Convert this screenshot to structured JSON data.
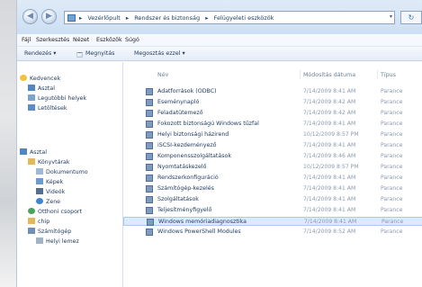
{
  "address": {
    "breadcrumbs": [
      "Vezérlőpult",
      "Rendszer és biztonság",
      "Felügyeleti eszközök"
    ],
    "separator": "▸"
  },
  "menu": [
    "Fájl",
    "Szerkesztés",
    "Nézet",
    "Eszközök",
    "Súgó"
  ],
  "commands": {
    "organize": "Rendezés ▾",
    "open": "Megnyitás",
    "share": "Megosztás ezzel ▾"
  },
  "navpane": {
    "favorites": "Kedvencek",
    "desktop": "Asztal",
    "recent": "Legutóbbi helyek",
    "downloads": "Letöltések",
    "desktop2": "Asztal",
    "libraries": "Könyvtárak",
    "documents": "Dokumentumo",
    "pictures": "Képek",
    "videos": "Videók",
    "music": "Zene",
    "homegroup": "Otthoni csoport",
    "chip": "chip",
    "computer": "Számítógép",
    "drive": "Helyi lemez"
  },
  "columns": {
    "name": "Név",
    "date": "Módosítás dátuma",
    "type": "Típus"
  },
  "files": [
    {
      "name": "Adatforrások (ODBC)",
      "date": "7/14/2009 8:41 AM",
      "type": "Parance"
    },
    {
      "name": "Eseménynapló",
      "date": "7/14/2009 8:42 AM",
      "type": "Parance"
    },
    {
      "name": "Feladatütemező",
      "date": "7/14/2009 8:42 AM",
      "type": "Parance"
    },
    {
      "name": "Fokozott biztonságú Windows tűzfal",
      "date": "7/14/2009 8:41 AM",
      "type": "Parance"
    },
    {
      "name": "Helyi biztonsági házirend",
      "date": "10/12/2009 8:57 PM",
      "type": "Parance"
    },
    {
      "name": "iSCSI-kezdeményező",
      "date": "7/14/2009 8:41 AM",
      "type": "Parance"
    },
    {
      "name": "Komponensszolgáltatások",
      "date": "7/14/2009 8:46 AM",
      "type": "Parance"
    },
    {
      "name": "Nyomtatáskezelő",
      "date": "10/12/2009 8:57 PM",
      "type": "Parance"
    },
    {
      "name": "Rendszerkonfiguráció",
      "date": "7/14/2009 8:41 AM",
      "type": "Parance"
    },
    {
      "name": "Számítógép-kezelés",
      "date": "7/14/2009 8:41 AM",
      "type": "Parance"
    },
    {
      "name": "Szolgáltatások",
      "date": "7/14/2009 8:41 AM",
      "type": "Parance"
    },
    {
      "name": "Teljesítményfigyelő",
      "date": "7/14/2009 8:41 AM",
      "type": "Parance"
    },
    {
      "name": "Windows memóriadiagnosztika",
      "date": "7/14/2009 8:41 AM",
      "type": "Parance"
    },
    {
      "name": "Windows PowerShell Modules",
      "date": "7/14/2009 8:52 AM",
      "type": "Parance"
    }
  ],
  "icons": {
    "back": "back-arrow-icon",
    "forward": "forward-arrow-icon",
    "refresh": "refresh-icon",
    "dropdown": "chevron-down-icon"
  },
  "colors": {
    "selection": "#dcebfc",
    "chrome": "#dfeaf7",
    "text": "#1e395b"
  }
}
